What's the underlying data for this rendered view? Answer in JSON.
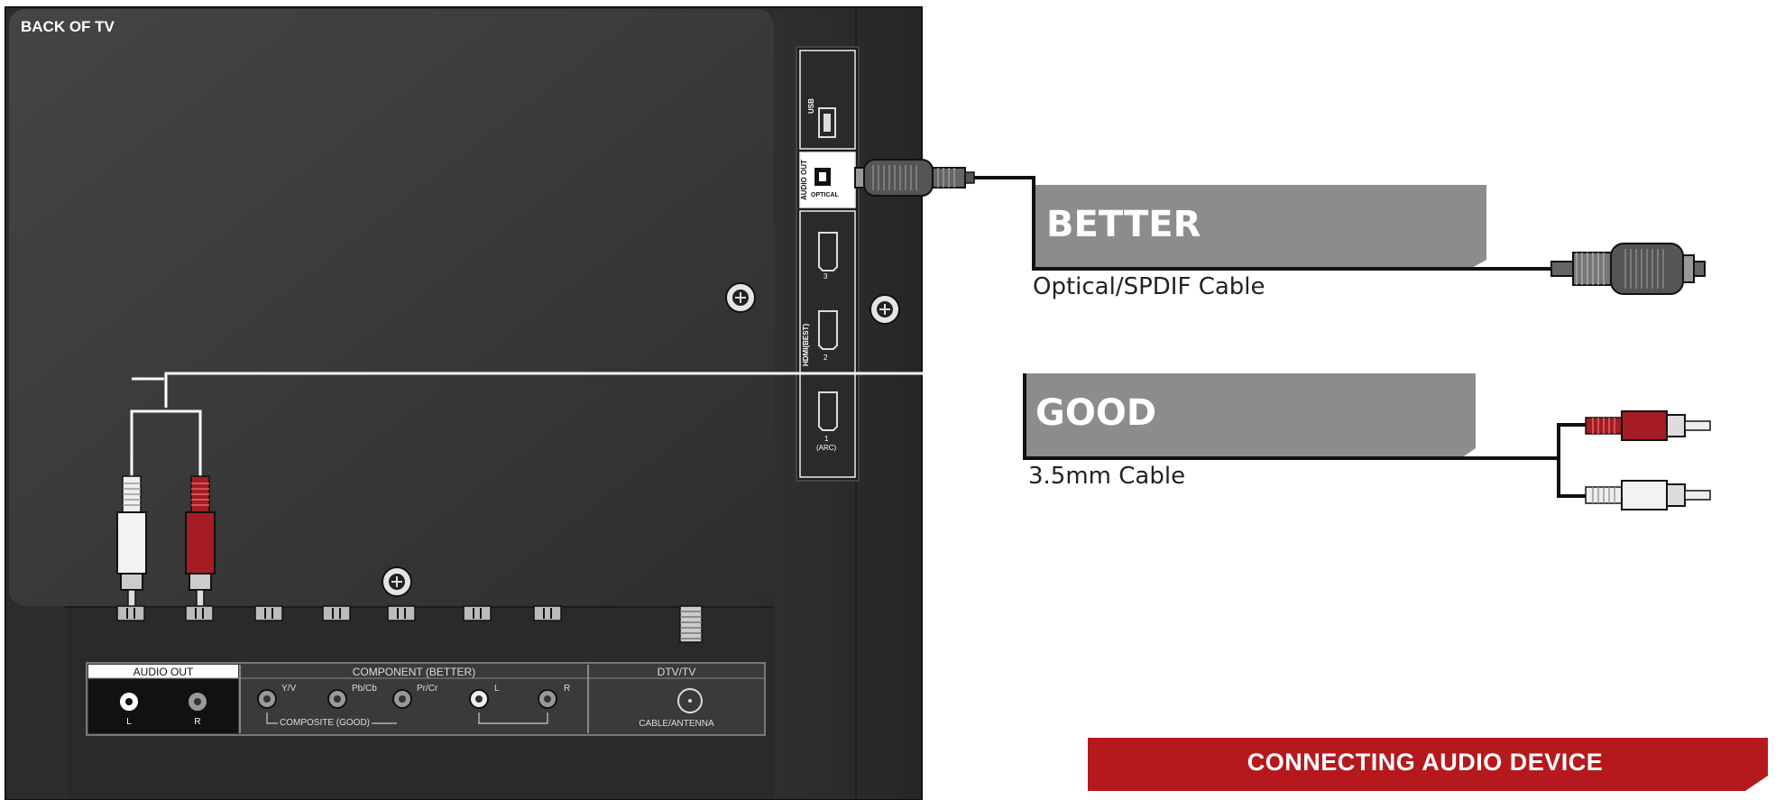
{
  "tv": {
    "back_label": "BACK OF TV",
    "side_ports": {
      "usb": "USB",
      "audio_out": "AUDIO OUT",
      "optical": "OPTICAL",
      "hdmi_group": "HDMI(BEST)",
      "hdmi3": "3",
      "hdmi2": "2",
      "hdmi1": "1",
      "hdmi1_arc": "(ARC)"
    },
    "bottom_panel": {
      "audio_out_title": "AUDIO OUT",
      "audio_l": "L",
      "audio_r": "R",
      "component_title": "COMPONENT (BETTER)",
      "y_v": "Y/V",
      "pb_cb": "Pb/Cb",
      "pr_cr": "Pr/Cr",
      "comp_l": "L",
      "comp_r": "R",
      "composite": "COMPOSITE (GOOD)",
      "dtv_title": "DTV/TV",
      "cable_antenna": "CABLE/ANTENNA"
    }
  },
  "options": {
    "better": {
      "heading": "BETTER",
      "cable": "Optical/SPDIF Cable"
    },
    "good": {
      "heading": "GOOD",
      "cable": "3.5mm Cable"
    }
  },
  "banner": {
    "title": "CONNECTING AUDIO DEVICE",
    "color": "#b5191e"
  },
  "colors": {
    "tv_dark": "#3a3a3a",
    "tv_edge": "#2b2b2b",
    "heading_gray": "#8c8c8c",
    "rca_red": "#a51c24"
  }
}
